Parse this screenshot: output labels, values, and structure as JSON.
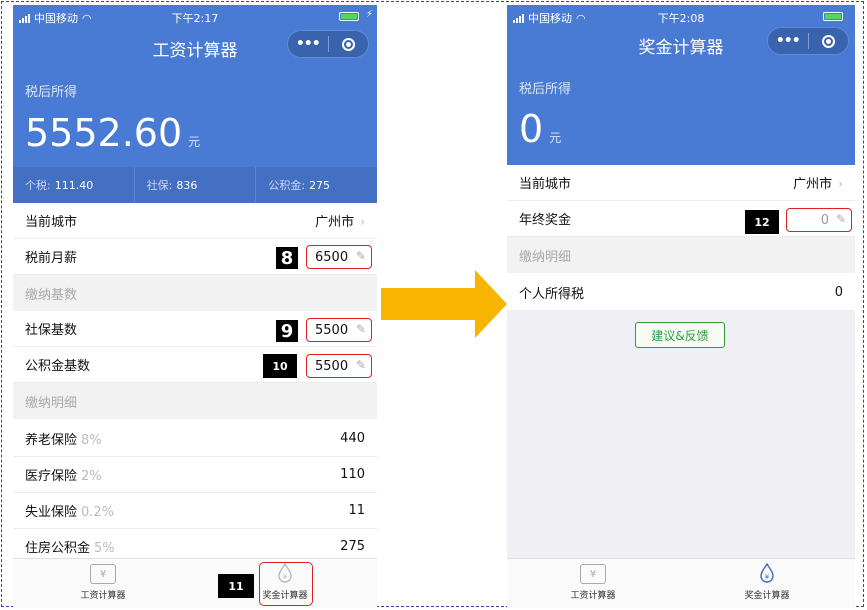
{
  "status": {
    "carrier": "中国移动"
  },
  "left": {
    "time": "下午2:17",
    "title": "工资计算器",
    "capsule_more": "•••",
    "after_tax_label": "税后所得",
    "after_tax_value": "5552.60",
    "unit": "元",
    "summary": [
      {
        "key": "个税:",
        "value": "111.40"
      },
      {
        "key": "社保:",
        "value": "836"
      },
      {
        "key": "公积金:",
        "value": "275"
      }
    ],
    "city_label": "当前城市",
    "city_value": "广州市",
    "salary_label": "税前月薪",
    "salary_value": "6500",
    "base_section": "缴纳基数",
    "social_base_label": "社保基数",
    "social_base_value": "5500",
    "fund_base_label": "公积金基数",
    "fund_base_value": "5500",
    "detail_section": "缴纳明细",
    "details": [
      {
        "label": "养老保险",
        "pct": "8%",
        "value": "440"
      },
      {
        "label": "医疗保险",
        "pct": "2%",
        "value": "110"
      },
      {
        "label": "失业保险",
        "pct": "0.2%",
        "value": "11"
      },
      {
        "label": "住房公积金",
        "pct": "5%",
        "value": "275"
      }
    ],
    "tabs": {
      "salary": "工资计算器",
      "bonus": "奖金计算器"
    },
    "tags": {
      "t8": "8",
      "t9": "9",
      "t10": "10",
      "t11": "11"
    }
  },
  "right": {
    "time": "下午2:08",
    "title": "奖金计算器",
    "capsule_more": "•••",
    "after_tax_label": "税后所得",
    "after_tax_value": "0",
    "unit": "元",
    "city_label": "当前城市",
    "city_value": "广州市",
    "bonus_label": "年终奖金",
    "bonus_placeholder": "0",
    "detail_section": "缴纳明细",
    "tax_label": "个人所得税",
    "tax_value": "0",
    "feedback": "建议&反馈",
    "tabs": {
      "salary": "工资计算器",
      "bonus": "奖金计算器"
    },
    "tags": {
      "t12": "12"
    }
  },
  "colors": {
    "header_blue": "#4a7bd4",
    "highlight_red": "#dd2222",
    "arrow": "#f7b500",
    "feedback_green": "#2e9c3e"
  },
  "icons": [
    "signal-icon",
    "wifi-icon",
    "battery-icon",
    "more-icon",
    "target-icon",
    "chevron-right-icon",
    "pencil-icon",
    "yen-card-icon",
    "yen-drop-icon",
    "right-arrow-icon"
  ]
}
